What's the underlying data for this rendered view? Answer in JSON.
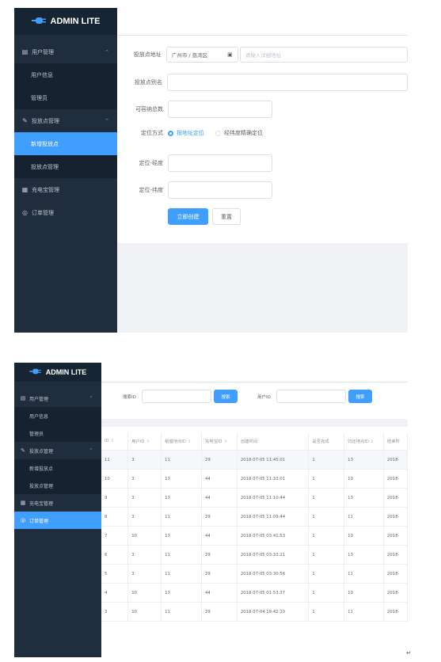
{
  "logo_text": "ADMIN LITE",
  "sidebar1": {
    "items": [
      {
        "label": "用户管理",
        "icon": "document-icon",
        "type": "top",
        "chevron": "⌃"
      },
      {
        "label": "用户信息",
        "type": "sub"
      },
      {
        "label": "管理员",
        "type": "sub"
      },
      {
        "label": "投放点管理",
        "icon": "edit-icon",
        "type": "top",
        "chevron": "⌃"
      },
      {
        "label": "新增投放点",
        "type": "sub",
        "active": true
      },
      {
        "label": "投放点管理",
        "type": "sub"
      },
      {
        "label": "充电宝管理",
        "icon": "grid-icon",
        "type": "top"
      },
      {
        "label": "订单管理",
        "icon": "check-circle-icon",
        "type": "top"
      }
    ]
  },
  "form": {
    "address_label": "投放点地址",
    "region_value": "广州市 / 荔湾区",
    "address_placeholder": "请输入详细地址",
    "alias_label": "投放点别名",
    "capacity_label": "可容纳总数",
    "locate_label": "定位方式",
    "locate_option1": "按地址定位",
    "locate_option2": "经纬度精确定位",
    "longitude_label": "定位-经度",
    "latitude_label": "定位-纬度",
    "create_button": "立即创建",
    "reset_button": "重置"
  },
  "sidebar2": {
    "items": [
      {
        "label": "用户管理",
        "icon": "document-icon",
        "type": "top",
        "chevron": "⌃"
      },
      {
        "label": "用户信息",
        "type": "sub"
      },
      {
        "label": "管理员",
        "type": "sub"
      },
      {
        "label": "投放点管理",
        "icon": "edit-icon",
        "type": "top",
        "chevron": "⌃"
      },
      {
        "label": "新增投放点",
        "type": "sub"
      },
      {
        "label": "投放点管理",
        "type": "sub"
      },
      {
        "label": "充电宝管理",
        "icon": "grid-icon",
        "type": "top"
      },
      {
        "label": "订单管理",
        "icon": "check-circle-icon",
        "type": "top",
        "active": true
      }
    ]
  },
  "search": {
    "search_id_label": "搜索ID",
    "search_button": "搜索",
    "user_id_label": "用户ID",
    "search_button2": "搜索"
  },
  "table": {
    "headers": [
      "ID",
      "用户ID",
      "租借地点ID",
      "充电宝ID",
      "创建时间",
      "是否完成",
      "归还地点ID",
      "结束时"
    ],
    "rows": [
      [
        "11",
        "3",
        "11",
        "29",
        "2018-07-05 11:45:01",
        "1",
        "13",
        "2018-"
      ],
      [
        "10",
        "3",
        "13",
        "44",
        "2018-07-05 11:33:01",
        "1",
        "10",
        "2018-"
      ],
      [
        "9",
        "3",
        "13",
        "44",
        "2018-07-05 11:10:44",
        "1",
        "13",
        "2018-"
      ],
      [
        "8",
        "3",
        "11",
        "29",
        "2018-07-05 11:09:44",
        "1",
        "11",
        "2018-"
      ],
      [
        "7",
        "10",
        "13",
        "44",
        "2018-07-05 03:41:53",
        "1",
        "10",
        "2018-"
      ],
      [
        "6",
        "3",
        "11",
        "29",
        "2018-07-05 03:33:21",
        "1",
        "13",
        "2018-"
      ],
      [
        "5",
        "3",
        "11",
        "29",
        "2018-07-05 03:30:56",
        "1",
        "11",
        "2018-"
      ],
      [
        "4",
        "10",
        "13",
        "44",
        "2018-07-05 01:53:37",
        "1",
        "10",
        "2018-"
      ],
      [
        "3",
        "10",
        "11",
        "29",
        "2018-07-04 19:42:10",
        "1",
        "11",
        "2018-"
      ]
    ]
  },
  "page_mark": "↵",
  "colors": {
    "sidebar": "#1f2d3d",
    "submenu": "#162230",
    "accent": "#409eff"
  }
}
